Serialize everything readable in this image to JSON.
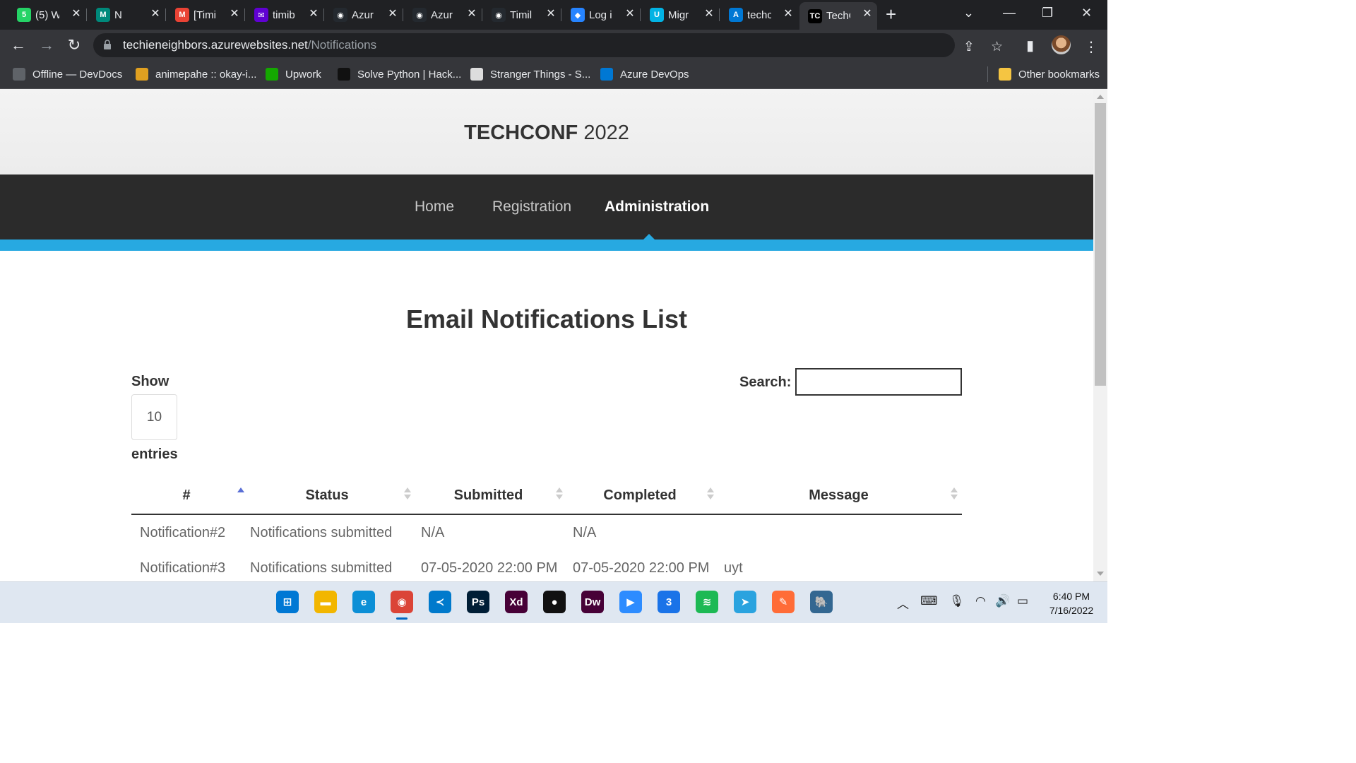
{
  "browser": {
    "tabs": [
      {
        "title": "(5) W",
        "icon": "whatsapp-icon",
        "color": "#25d366",
        "glyph": "5"
      },
      {
        "title": "N",
        "icon": "google-meet-icon",
        "color": "#00897b",
        "glyph": "M"
      },
      {
        "title": "[Timi",
        "icon": "gmail-icon",
        "color": "#ea4335",
        "glyph": "M"
      },
      {
        "title": "timib",
        "icon": "yahoo-mail-icon",
        "color": "#6001d2",
        "glyph": "✉"
      },
      {
        "title": "Azur",
        "icon": "github-icon",
        "color": "#24292f",
        "glyph": "◉"
      },
      {
        "title": "Azur",
        "icon": "github-icon",
        "color": "#24292f",
        "glyph": "◉"
      },
      {
        "title": "Timil",
        "icon": "github-icon",
        "color": "#24292f",
        "glyph": "◉"
      },
      {
        "title": "Log i",
        "icon": "jira-icon",
        "color": "#2684ff",
        "glyph": "◆"
      },
      {
        "title": "Migr",
        "icon": "udacity-icon",
        "color": "#02b3e4",
        "glyph": "U"
      },
      {
        "title": "techc",
        "icon": "azure-icon",
        "color": "#0078d4",
        "glyph": "A"
      },
      {
        "title": "TechC",
        "icon": "techconf-icon",
        "color": "#000000",
        "glyph": "TC",
        "active": true
      }
    ],
    "url_host": "techieneighbors.azurewebsites.net",
    "url_path": "/Notifications",
    "bookmarks": [
      {
        "label": "Offline — DevDocs",
        "icon": "devdocs-icon",
        "color": "#5f6368"
      },
      {
        "label": "animepahe :: okay-i...",
        "icon": "animepahe-icon",
        "color": "#e0a020"
      },
      {
        "label": "Upwork",
        "icon": "upwork-icon",
        "color": "#14a800"
      },
      {
        "label": "Solve Python | Hack...",
        "icon": "hackerrank-icon",
        "color": "#111111"
      },
      {
        "label": "Stranger Things - S...",
        "icon": "stranger-things-icon",
        "color": "#dddddd"
      },
      {
        "label": "Azure DevOps",
        "icon": "azure-devops-icon",
        "color": "#0078d4"
      }
    ],
    "other_bookmarks": "Other bookmarks"
  },
  "site": {
    "brand_name": "TECHCONF",
    "brand_year": "2022",
    "nav": {
      "home": "Home",
      "registration": "Registration",
      "administration": "Administration"
    }
  },
  "main": {
    "title": "Email Notifications List",
    "show_label": "Show",
    "page_length": "10",
    "entries_label": "entries",
    "search_label": "Search:",
    "search_value": "",
    "table": {
      "columns": [
        "#",
        "Status",
        "Submitted",
        "Completed",
        "Message"
      ],
      "sorted_column": "#",
      "sort_direction": "ascending",
      "rows": [
        [
          "Notification#2",
          "Notifications submitted",
          "N/A",
          "N/A",
          ""
        ],
        [
          "Notification#3",
          "Notifications submitted",
          "07-05-2020 22:00 PM",
          "07-05-2020 22:00 PM",
          "uyt"
        ]
      ]
    }
  },
  "taskbar": {
    "apps": [
      {
        "name": "windows-start-icon",
        "glyph": "⊞",
        "color": "#0078d4"
      },
      {
        "name": "file-explorer-icon",
        "glyph": "▬",
        "color": "#f2b600"
      },
      {
        "name": "edge-icon",
        "glyph": "e",
        "color": "#0c8fd6"
      },
      {
        "name": "chrome-icon",
        "glyph": "◉",
        "color": "#db4437",
        "active": true
      },
      {
        "name": "vscode-icon",
        "glyph": "≺",
        "color": "#007acc"
      },
      {
        "name": "photoshop-icon",
        "glyph": "Ps",
        "color": "#001e36"
      },
      {
        "name": "adobe-xd-icon",
        "glyph": "Xd",
        "color": "#470137"
      },
      {
        "name": "screen-recorder-icon",
        "glyph": "●",
        "color": "#111111"
      },
      {
        "name": "dreamweaver-icon",
        "glyph": "Dw",
        "color": "#470137"
      },
      {
        "name": "zoom-icon",
        "glyph": "▶",
        "color": "#2d8cff"
      },
      {
        "name": "app-3-icon",
        "glyph": "3",
        "color": "#1a73e8"
      },
      {
        "name": "spotify-icon",
        "glyph": "≋",
        "color": "#1db954"
      },
      {
        "name": "telegram-icon",
        "glyph": "➤",
        "color": "#2aa3df"
      },
      {
        "name": "postman-icon",
        "glyph": "✎",
        "color": "#ff6c37"
      },
      {
        "name": "postgresql-icon",
        "glyph": "🐘",
        "color": "#336791"
      }
    ],
    "time": "6:40 PM",
    "date": "7/16/2022"
  }
}
